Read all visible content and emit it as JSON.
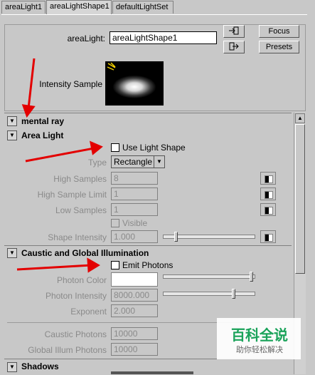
{
  "tabs": [
    {
      "label": "areaLight1"
    },
    {
      "label": "areaLightShape1"
    },
    {
      "label": "defaultLightSet"
    }
  ],
  "header": {
    "area_light_label": "areaLight:",
    "area_light_value": "areaLightShape1",
    "focus_label": "Focus",
    "presets_label": "Presets",
    "intensity_sample_label": "Intensity Sample"
  },
  "mental_ray": {
    "title": "mental ray",
    "area_light": {
      "title": "Area Light",
      "use_light_shape_label": "Use Light Shape",
      "type_label": "Type",
      "type_value": "Rectangle",
      "high_samples_label": "High Samples",
      "high_samples_value": "8",
      "high_sample_limit_label": "High Sample Limit",
      "high_sample_limit_value": "1",
      "low_samples_label": "Low Samples",
      "low_samples_value": "1",
      "visible_label": "Visible",
      "shape_intensity_label": "Shape Intensity",
      "shape_intensity_value": "1.000",
      "shape_intensity_level": 0.12
    },
    "caustic": {
      "title": "Caustic and Global Illumination",
      "emit_photons_label": "Emit Photons",
      "photon_color_label": "Photon Color",
      "photon_color_hex": "#ffffff",
      "photon_color_level": 0.98,
      "photon_intensity_label": "Photon Intensity",
      "photon_intensity_value": "8000.000",
      "photon_intensity_level": 0.78,
      "exponent_label": "Exponent",
      "exponent_value": "2.000",
      "caustic_photons_label": "Caustic Photons",
      "caustic_photons_value": "10000",
      "global_illum_photons_label": "Global Illum Photons",
      "global_illum_photons_value": "10000"
    },
    "shadows": {
      "title": "Shadows"
    }
  },
  "watermark": {
    "title": "百科全说",
    "subtitle": "助你轻松解决"
  },
  "colors": {
    "annotation_arrow": "#e30000",
    "watermark_green": "#1aa35a"
  }
}
